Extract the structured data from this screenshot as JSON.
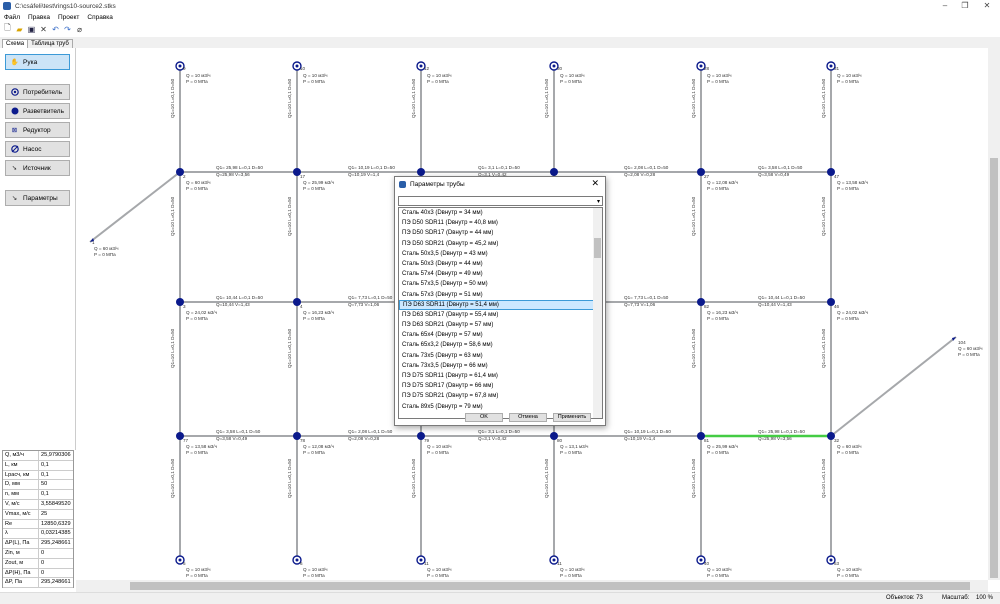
{
  "window": {
    "title": "C:\\csáfeli\\test\\rings10-source2.stks"
  },
  "menu": [
    "Файл",
    "Правка",
    "Проект",
    "Справка"
  ],
  "tabs": [
    "Схема",
    "Таблица труб"
  ],
  "tools": {
    "hand": "Рука",
    "consumer": "Потребитель",
    "splitter": "Разветвитель",
    "reducer": "Редуктор",
    "pump": "Насос",
    "source": "Источник",
    "params": "Параметры"
  },
  "properties": [
    {
      "k": "Q, м3/ч",
      "v": "25,9790306"
    },
    {
      "k": "L, км",
      "v": "0,1"
    },
    {
      "k": "Lрасч, км",
      "v": "0,1"
    },
    {
      "k": "D, мм",
      "v": "50"
    },
    {
      "k": "n, мм",
      "v": "0,1"
    },
    {
      "k": "V, м/с",
      "v": "3,55849520"
    },
    {
      "k": "Vmax, м/с",
      "v": "25"
    },
    {
      "k": "Re",
      "v": "12850,6329"
    },
    {
      "k": "λ",
      "v": "0,03214385"
    },
    {
      "k": "ΔP(L), Па",
      "v": "295,248661"
    },
    {
      "k": "Zin, м",
      "v": "0"
    },
    {
      "k": "Zout, м",
      "v": "0"
    },
    {
      "k": "ΔP(H), Па",
      "v": "0"
    },
    {
      "k": "ΔP, Па",
      "v": "295,248661"
    }
  ],
  "status": {
    "objects": "Объектов: 73",
    "scale_label": "Масштаб:",
    "scale_value": "100 %"
  },
  "dialog": {
    "title": "Параметры трубы",
    "items": [
      "Сталь 40x3 (Dвнутр = 34 мм)",
      "ПЭ D50 SDR11 (Dвнутр = 40,8 мм)",
      "ПЭ D50 SDR17 (Dвнутр = 44 мм)",
      "ПЭ D50 SDR21 (Dвнутр = 45,2 мм)",
      "Сталь 50x3,5 (Dвнутр = 43 мм)",
      "Сталь 50x3 (Dвнутр = 44 мм)",
      "Сталь 57x4 (Dвнутр = 49 мм)",
      "Сталь 57x3,5 (Dвнутр = 50 мм)",
      "Сталь 57x3 (Dвнутр = 51 мм)",
      "ПЭ D63 SDR11 (Dвнутр = 51,4 мм)",
      "ПЭ D63 SDR17 (Dвнутр = 55,4 мм)",
      "ПЭ D63 SDR21 (Dвнутр = 57 мм)",
      "Сталь 65x4 (Dвнутр = 57 мм)",
      "Сталь 65x3,2 (Dвнутр = 58,6 мм)",
      "Сталь 73x5 (Dвнутр = 63 мм)",
      "Сталь 73x3,5 (Dвнутр = 66 мм)",
      "ПЭ D75 SDR11 (Dвнутр = 61,4 мм)",
      "ПЭ D75 SDR17 (Dвнутр = 66 мм)",
      "ПЭ D75 SDR21 (Dвнутр = 67,8 мм)",
      "Сталь 89x5 (Dвнутр = 79 мм)"
    ],
    "selected_index": 9,
    "buttons": [
      "OK",
      "Отмена",
      "Применить"
    ]
  },
  "diagram": {
    "junctions": [
      {
        "id": "2",
        "q": "Q = 60 м3/ч",
        "p": "P = 0 МПа"
      },
      {
        "id": "3",
        "q": "Q = 24,02 м3/ч",
        "p": "P = 0 МПа"
      },
      {
        "id": "77",
        "q": "Q = 13,58 м3/ч",
        "p": "P = 0 МПа"
      },
      {
        "id": "17",
        "q": "Q = 25,99 м3/ч",
        "p": "P = 0 МПа"
      },
      {
        "id": "4",
        "q": "Q = 16,23 м3/ч",
        "p": "P = 0 МПа"
      },
      {
        "id": "78",
        "q": "Q = 12,08 м3/ч",
        "p": "P = 0 МПа"
      },
      {
        "id": "79",
        "q": "Q = 10 м3/ч",
        "p": "P = 0 МПа"
      },
      {
        "id": "80",
        "q": "Q = 13,1 м3/ч",
        "p": "P = 0 МПа"
      },
      {
        "id": "27",
        "q": "Q = 12,08 м3/ч",
        "p": "P = 0 МПа"
      },
      {
        "id": "82",
        "q": "Q = 16,23 м3/ч",
        "p": "P = 0 МПа"
      },
      {
        "id": "81",
        "q": "Q = 25,99 м3/ч",
        "p": "P = 0 МПа"
      },
      {
        "id": "47",
        "q": "Q = 13,58 м3/ч",
        "p": "P = 0 МПа"
      },
      {
        "id": "46",
        "q": "Q = 24,02 м3/ч",
        "p": "P = 0 МПа"
      },
      {
        "id": "32",
        "q": "Q = 60 м3/ч",
        "p": "P = 0 МПа"
      }
    ],
    "consumers_top": [
      {
        "id": "9",
        "q": "Q = 10 м3/ч",
        "p": "P = 0 МПа"
      },
      {
        "id": "10",
        "q": "Q = 10 м3/ч",
        "p": "P = 0 МПа"
      },
      {
        "id": "12",
        "q": "Q = 10 м3/ч",
        "p": "P = 0 МПа"
      },
      {
        "id": "30",
        "q": "Q = 10 м3/ч",
        "p": "P = 0 МПа"
      },
      {
        "id": "28",
        "q": "Q = 10 м3/ч",
        "p": "P = 0 МПа"
      },
      {
        "id": "31",
        "q": "Q = 10 м3/ч",
        "p": "P = 0 МПа"
      }
    ],
    "consumers_bottom": [
      {
        "id": "5",
        "q": "Q = 10 м3/ч",
        "p": "P = 0 МПа"
      },
      {
        "id": "6",
        "q": "Q = 10 м3/ч",
        "p": "P = 0 МПа"
      },
      {
        "id": "11",
        "q": "Q = 10 м3/ч",
        "p": "P = 0 МПа"
      },
      {
        "id": "11",
        "q": "Q = 10 м3/ч",
        "p": "P = 0 МПа"
      },
      {
        "id": "40",
        "q": "Q = 10 м3/ч",
        "p": "P = 0 МПа"
      },
      {
        "id": "53",
        "q": "Q = 10 м3/ч",
        "p": "P = 0 МПа"
      }
    ],
    "sources": [
      {
        "id": "1",
        "q": "Q = 60 м3/ч",
        "p": "P = 0 МПа"
      },
      {
        "id": "104",
        "q": "Q = 60 м3/ч",
        "p": "P = 0 МПа"
      }
    ],
    "h_labels": {
      "r1_a": "Q1= 25,98   L=0,1   D=50",
      "r1_a2": "Q=25,98   V=3,56",
      "r1_b": "Q1= 10,19   L=0,1   D=50",
      "r1_b2": "Q=10,19   V=1,4",
      "r1_c": "Q1= 3,1   L=0,1   D=50",
      "r1_c2": "Q=3,1   V=0,42",
      "r1_d": "Q1= 2,08   L=0,1   D=50",
      "r1_d2": "Q=2,08   V=0,28",
      "r1_e": "Q1= 3,58   L=0,1   D=50",
      "r1_e2": "Q=3,58   V=0,49",
      "r2_a": "Q1= 10,44   L=0,1   D=50",
      "r2_a2": "Q=10,44   V=1,43",
      "r2_b": "Q1= 7,73   L=0,1   D=50",
      "r2_b2": "Q=7,73   V=1,06",
      "r2_c": "Q1= 7,73   L=0,1   D=50",
      "r2_c2": "Q=7,73   V=1,06",
      "r2_d": "Q1= 10,44   L=0,1   D=50",
      "r2_d2": "Q=10,44   V=1,43",
      "r3_a": "Q1= 3,58   L=0,1   D=50",
      "r3_a2": "Q=3,58   V=0,49",
      "r3_b": "Q1= 2,08   L=0,1   D=50",
      "r3_b2": "Q=2,08   V=0,28",
      "r3_c": "Q1= 3,1   L=0,1   D=50",
      "r3_c2": "Q=3,1   V=0,42",
      "r3_d": "Q1= 10,19   L=0,1   D=50",
      "r3_d2": "Q=10,19   V=1,4",
      "r3_e": "Q1= 25,98   L=0,1   D=50",
      "r3_e2": "Q=25,98   V=3,56"
    },
    "v_label": "Q1=10   L=0,1   D=50"
  },
  "colors": {
    "pipe": "#a6a8ab",
    "node": "#0b1a8c",
    "highlight": "#44cc44",
    "selection": "#cce8ff"
  }
}
